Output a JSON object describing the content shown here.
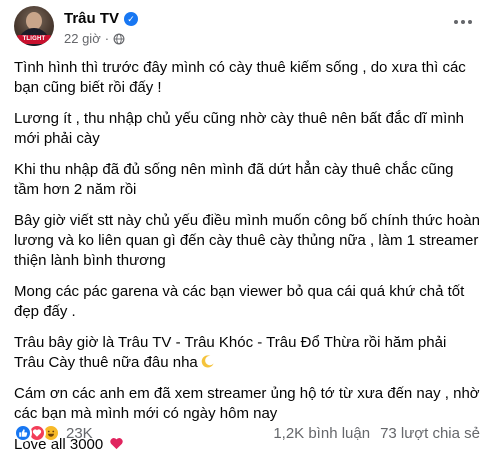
{
  "header": {
    "page_name": "Trâu TV",
    "avatar_badge": "TLIGHT",
    "time": "22 giờ",
    "separator": "·"
  },
  "post": {
    "paragraphs": [
      "Tình hình thì trước đây mình có cày thuê kiếm sống , do xưa thì các bạn cũng biết rồi đấy !",
      "Lương ít , thu nhập chủ yếu cũng nhờ cày thuê nên bất đắc dĩ mình mới phải cày",
      "Khi thu nhập đã đủ sống nên mình đã dứt hẳn cày thuê chắc cũng tầm hơn 2 năm rồi",
      "Bây giờ viết stt này chủ yếu điều mình muốn công bố chính thức hoàn lương và ko liên quan gì đến cày thuê cày thủng nữa , làm 1 streamer thiện lành bình thương",
      "Mong các pác garena và các bạn viewer bỏ qua cái quá khứ chả tốt đẹp đấy .",
      "Trâu bây giờ là Trâu TV - Trâu Khóc - Trâu Đổ Thừa rồi hăm phải Trâu Cày thuê nữa đâu nha",
      "Cám ơn các anh em đã xem streamer ủng hộ tớ từ xưa đến nay , nhờ các bạn mà mình mới có ngày hôm nay",
      "Love all 3000"
    ]
  },
  "footer": {
    "reaction_count": "23K",
    "comments": "1,2K bình luận",
    "shares": "73 lượt chia sẻ"
  },
  "colors": {
    "accent": "#1877f2",
    "love": "#f33e58",
    "haha": "#f7b928",
    "secondary_text": "#65676b"
  },
  "icons": [
    "verified-badge-icon",
    "globe-icon",
    "more-options-icon",
    "crescent-moon-emoji",
    "red-heart-emoji",
    "like-reaction-icon",
    "love-reaction-icon",
    "haha-reaction-icon"
  ]
}
